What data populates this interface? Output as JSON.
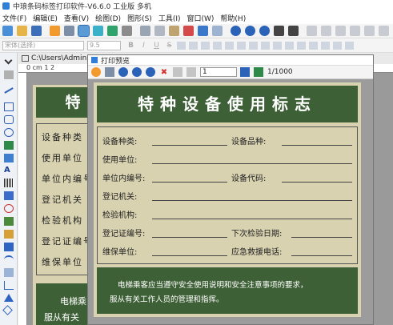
{
  "app": {
    "title": "中琅条码标签打印软件-V6.6.0 工业版 多机"
  },
  "menu": [
    "文件(F)",
    "编辑(E)",
    "查看(V)",
    "绘图(D)",
    "图形(S)",
    "工具(I)",
    "窗口(W)",
    "帮助(H)"
  ],
  "format": {
    "font_placeholder": "宋体(选择)",
    "size_placeholder": "9.5",
    "bold": "B",
    "italic": "I",
    "underline": "U",
    "strike": "S"
  },
  "document": {
    "path": "C:\\Users\\Administ",
    "ruler_text": "0 cm   1      2"
  },
  "preview": {
    "title": "打印预览",
    "page_value": "1",
    "page_count": "1/1000"
  },
  "label": {
    "title": "特种设备使用标志",
    "fields": {
      "device_type": "设备种类:",
      "device_variety": "设备品种:",
      "user_unit": "使用单位:",
      "internal_no": "单位内编号:",
      "device_code": "设备代码:",
      "reg_authority": "登记机关:",
      "inspection_org": "检验机构:",
      "reg_cert_no": "登记证编号:",
      "next_inspection": "下次检验日期:",
      "maintenance_unit": "维保单位:",
      "emergency_phone": "应急救援电话:"
    },
    "footer": {
      "line1": "电梯乘客应当遵守安全使用说明和安全注意事项的要求，",
      "line2": "服从有关工作人员的管理和指挥。"
    }
  },
  "background_label": {
    "title": "特",
    "rows": [
      "设备种类",
      "使用单位",
      "单位内编号",
      "登记机关",
      "检验机构",
      "登记证编号",
      "维保单位"
    ],
    "footer1": "电梯乘",
    "footer2": "服从有关"
  },
  "colors": {
    "header_green": "#3e6036",
    "label_beige": "#d8d2b0",
    "accent_blue": "#2f7fd9"
  }
}
